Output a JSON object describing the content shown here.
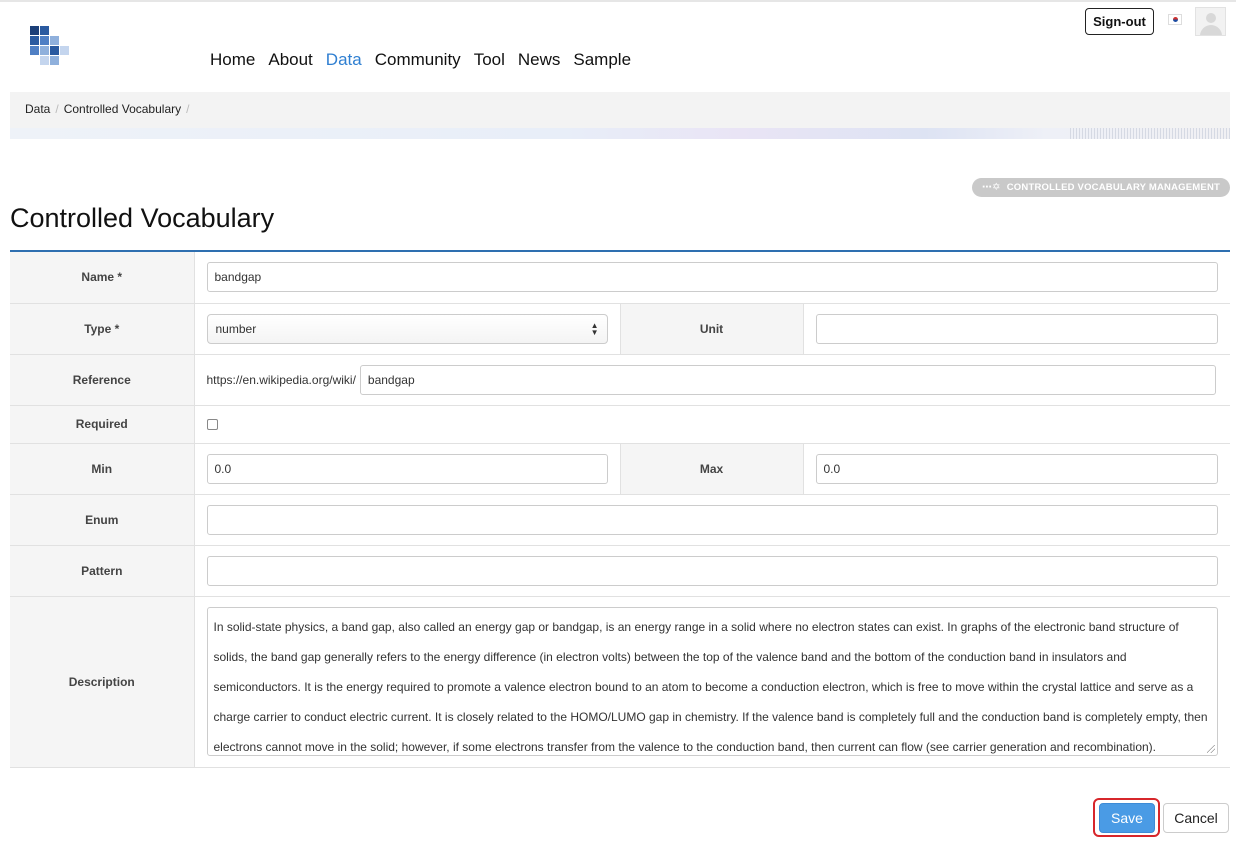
{
  "header": {
    "nav": [
      {
        "label": "Home",
        "active": false
      },
      {
        "label": "About",
        "active": false
      },
      {
        "label": "Data",
        "active": true
      },
      {
        "label": "Community",
        "active": false
      },
      {
        "label": "Tool",
        "active": false
      },
      {
        "label": "News",
        "active": false
      },
      {
        "label": "Sample",
        "active": false
      }
    ],
    "signout_label": "Sign-out",
    "accent_color": "#2f7fd1"
  },
  "breadcrumb": [
    "Data",
    "Controlled Vocabulary"
  ],
  "page": {
    "title": "Controlled Vocabulary",
    "management_button": "CONTROLLED VOCABULARY MANAGEMENT"
  },
  "form": {
    "name": {
      "label": "Name *",
      "value": "bandgap"
    },
    "type": {
      "label": "Type *",
      "value": "number"
    },
    "unit": {
      "label": "Unit",
      "value": ""
    },
    "reference": {
      "label": "Reference",
      "prefix": "https://en.wikipedia.org/wiki/",
      "value": "bandgap"
    },
    "required": {
      "label": "Required",
      "checked": false
    },
    "min": {
      "label": "Min",
      "value": "0.0"
    },
    "max": {
      "label": "Max",
      "value": "0.0"
    },
    "enum": {
      "label": "Enum",
      "value": ""
    },
    "pattern": {
      "label": "Pattern",
      "value": ""
    },
    "description": {
      "label": "Description",
      "lines": [
        "In solid-state physics, a band gap, also called an energy gap or bandgap, is an energy range in a solid where no electron states can exist. In graphs of the electronic band structure of",
        "solids, the band gap generally refers to the energy difference (in electron volts) between the top of the valence band and the bottom of the conduction band in insulators and",
        "semiconductors. It is the energy required to promote a valence electron bound to an atom to become a conduction electron, which is free to move within the crystal lattice and serve as a",
        "charge carrier to conduct electric current. It is closely related to the HOMO/LUMO gap in chemistry. If the valence band is completely full and the conduction band is completely empty, then",
        "electrons cannot move in the solid; however, if some electrons transfer from the valence to the conduction band, then current can flow (see carrier generation and recombination)."
      ]
    }
  },
  "actions": {
    "save_label": "Save",
    "cancel_label": "Cancel",
    "save_color": "#4a9be5",
    "highlight_color": "#d7262b"
  }
}
